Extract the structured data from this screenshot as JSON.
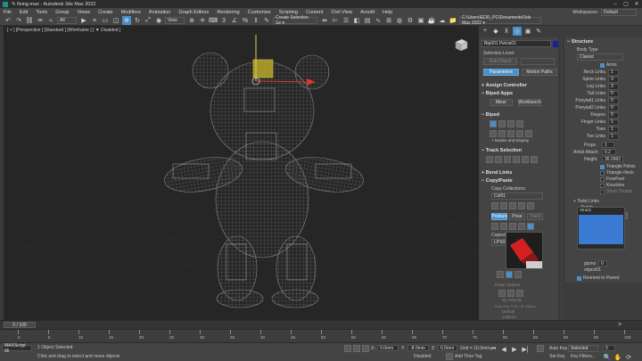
{
  "window": {
    "title": "✎ fixing.max - Autodesk 3ds Max 2022"
  },
  "menu": [
    "File",
    "Edit",
    "Tools",
    "Group",
    "Views",
    "Create",
    "Modifiers",
    "Animation",
    "Graph Editors",
    "Rendering",
    "Customize",
    "Scripting",
    "Content",
    "Civil View",
    "Arnold",
    "Help"
  ],
  "menu_right": {
    "workspaces_label": "Workspaces:",
    "workspaces_value": "Default"
  },
  "toolbar": {
    "undo_count": "3",
    "all_filter": "All",
    "view_dropdown": "View",
    "selection_set_placeholder": "Create Selection Se ▾",
    "path": "C:\\Users\\EDD_PC\\Documents\\3ds Max 2022 ▾"
  },
  "viewport": {
    "label": "[ + ] [Perspective ] [Standard ] [Wireframe ]  [ ▼ Disabled ]"
  },
  "motion_panel": {
    "object_name": "Bip001 Pelvis01",
    "selection_level_label": "Selection Level:",
    "sub_anim_label": "Sub-Object",
    "parameters_tab": "Parameters",
    "motion_paths_tab": "Motion Paths",
    "sections": {
      "assign_controller": "Assign Controller",
      "biped_apps": "Biped Apps",
      "biped": "Biped",
      "track_selection": "Track Selection",
      "bend_links": "Bend Links",
      "copy_paste": "Copy/Paste"
    },
    "biped_apps_buttons": [
      "Mixer",
      "Workbench"
    ],
    "modes_display_label": "Modes and Display",
    "copy_collections_label": "Copy Collections:",
    "collection_value": "Col01",
    "cpp_tabs": [
      "Posture",
      "Pose",
      "Track"
    ],
    "copied_postures_label": "Copied Postures:",
    "posture_value": "LPS02",
    "paste_options_label": "Paste Options",
    "by_velocity_label": "By Velocity",
    "auto_key_tcb_label": "Auto-Key TCB / IK Values",
    "default_label": "Default",
    "capture_label": "Capture"
  },
  "structure_panel": {
    "title": "Structure",
    "body_type_label": "Body Type",
    "body_type_value": "Classic",
    "arms_label": "Arms",
    "fields": [
      {
        "label": "Neck Links",
        "value": "1"
      },
      {
        "label": "Spine Links",
        "value": "3"
      },
      {
        "label": "Leg Links",
        "value": "3"
      },
      {
        "label": "Tail Links",
        "value": "0"
      },
      {
        "label": "Ponytail1 Links",
        "value": "0"
      },
      {
        "label": "Ponytail2 Links",
        "value": "0"
      },
      {
        "label": "Fingers",
        "value": "0"
      },
      {
        "label": "Finger Links",
        "value": "1"
      },
      {
        "label": "Toes",
        "value": "1"
      },
      {
        "label": "Toe Links",
        "value": "1"
      }
    ],
    "props_label": "Props",
    "props_value": "1",
    "ankle_attach_label": "Ankle Attach",
    "ankle_attach_value": "0.2",
    "height_label": "Height",
    "height_value": "36.0962",
    "triangle_pelvis": "Triangle Pelvis",
    "triangle_neck": "Triangle Neck",
    "forefeet": "ForeFeet",
    "knuckles": "Knuckles",
    "short_thumb": "Short Thumb",
    "twist_links_label": "Twist Links",
    "twists_label": "Twists",
    "list_header": "Xtra01",
    "gizmo_label": "gizmo",
    "gizmo_value": "0",
    "object_label": "object01",
    "reorient_label": "Reorient to Parent"
  },
  "timeline": {
    "frame_label": "0 / 100",
    "ticks": [
      "0",
      "5",
      "10",
      "15",
      "20",
      "25",
      "30",
      "35",
      "40",
      "45",
      "50",
      "55",
      "60",
      "65",
      "70",
      "75",
      "80",
      "85",
      "90",
      "95",
      "100"
    ]
  },
  "status": {
    "maxscript": "MAXScript Mi",
    "selected": "1 Object Selected",
    "prompt": "Click and drag to select and move objects",
    "x_label": "X:",
    "x_value": "0.0mm",
    "y_label": "Y:",
    "y_value": "-8.0mm",
    "z_label": "Z:",
    "z_value": "6.0mm",
    "grid": "Grid = 10.0mm",
    "add_time_tag": "Add Time Tag",
    "auto_key": "Auto Key",
    "selected_filter": "Selected",
    "set_key": "Set Key",
    "key_filters": "Key Filters...",
    "disabled": "Disabled",
    "frame": "0"
  }
}
